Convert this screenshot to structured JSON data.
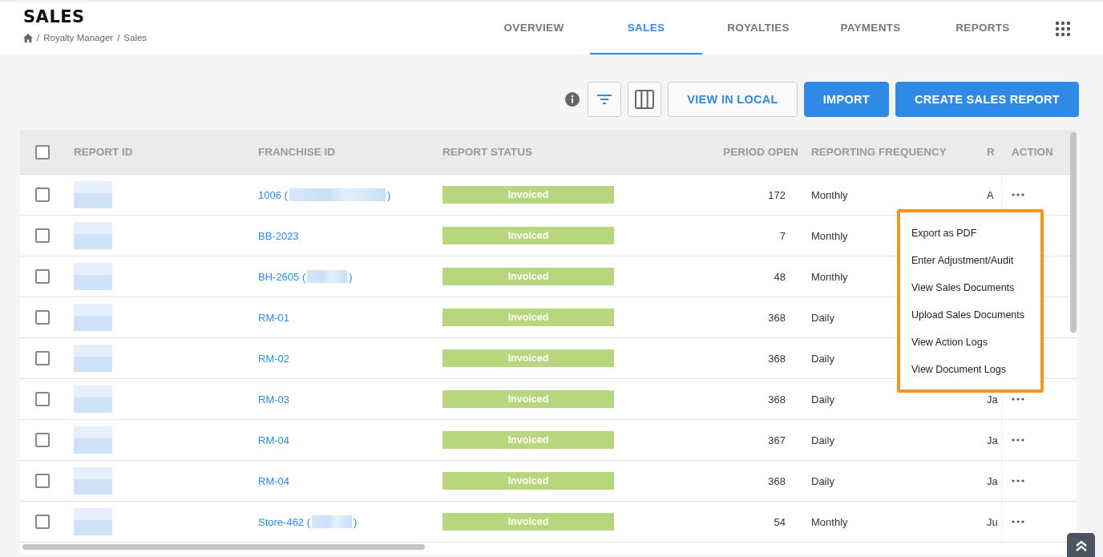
{
  "page": {
    "title": "SALES",
    "breadcrumb": [
      {
        "separator": "/",
        "label": "Royalty Manager"
      },
      {
        "separator": "/",
        "label": "Sales"
      }
    ]
  },
  "tabs": [
    {
      "label": "OVERVIEW",
      "selected": false
    },
    {
      "label": "SALES",
      "selected": true
    },
    {
      "label": "ROYALTIES",
      "selected": false
    },
    {
      "label": "PAYMENTS",
      "selected": false
    },
    {
      "label": "REPORTS",
      "selected": false
    }
  ],
  "toolbar": {
    "buttons": [
      {
        "label": "VIEW IN LOCAL",
        "kind": "outline"
      },
      {
        "label": "IMPORT",
        "kind": "primary"
      },
      {
        "label": "CREATE SALES REPORT",
        "kind": "primary"
      }
    ]
  },
  "table": {
    "all_checked": false,
    "columns": [
      "REPORT ID",
      "FRANCHISE ID",
      "REPORT STATUS",
      "PERIOD OPEN",
      "REPORTING FREQUENCY",
      "R",
      "ACTION"
    ],
    "rows": [
      {
        "checked": false,
        "franchise_id": "1006 (",
        "franchise_redacted": true,
        "franchise_close": ")",
        "status": "Invoiced",
        "period_open": "172",
        "frequency": "Monthly",
        "column_6": "A",
        "has_action": true
      },
      {
        "checked": false,
        "franchise_id": "BB-2023",
        "franchise_redacted": false,
        "status": "Invoiced",
        "period_open": "7",
        "frequency": "Monthly"
      },
      {
        "checked": false,
        "franchise_id": "BH-2605 (",
        "franchise_redacted": true,
        "franchise_close": ")",
        "status": "Invoiced",
        "period_open": "48",
        "frequency": "Monthly"
      },
      {
        "checked": false,
        "franchise_id": "RM-01",
        "franchise_redacted": false,
        "status": "Invoiced",
        "period_open": "368",
        "frequency": "Daily"
      },
      {
        "checked": false,
        "franchise_id": "RM-02",
        "franchise_redacted": false,
        "status": "Invoiced",
        "period_open": "368",
        "frequency": "Daily"
      },
      {
        "checked": false,
        "franchise_id": "RM-03",
        "franchise_redacted": false,
        "status": "Invoiced",
        "period_open": "368",
        "frequency": "Daily",
        "column_6": "Ja",
        "has_action": true
      },
      {
        "checked": false,
        "franchise_id": "RM-04",
        "franchise_redacted": false,
        "status": "Invoiced",
        "period_open": "367",
        "frequency": "Daily",
        "column_6": "Ja",
        "has_action": true
      },
      {
        "checked": false,
        "franchise_id": "RM-04",
        "franchise_redacted": false,
        "status": "Invoiced",
        "period_open": "368",
        "frequency": "Daily",
        "column_6": "Ja",
        "has_action": true
      },
      {
        "checked": false,
        "franchise_id": "Store-462 (",
        "franchise_redacted": true,
        "franchise_close": ")",
        "status": "Invoiced",
        "period_open": "54",
        "frequency": "Monthly",
        "column_6": "Ju",
        "has_action": true
      }
    ]
  },
  "menu": {
    "items": [
      "Export as PDF",
      "Enter Adjustment/Audit",
      "View Sales Documents",
      "Upload Sales Documents",
      "View Action Logs",
      "View Document Logs"
    ]
  }
}
